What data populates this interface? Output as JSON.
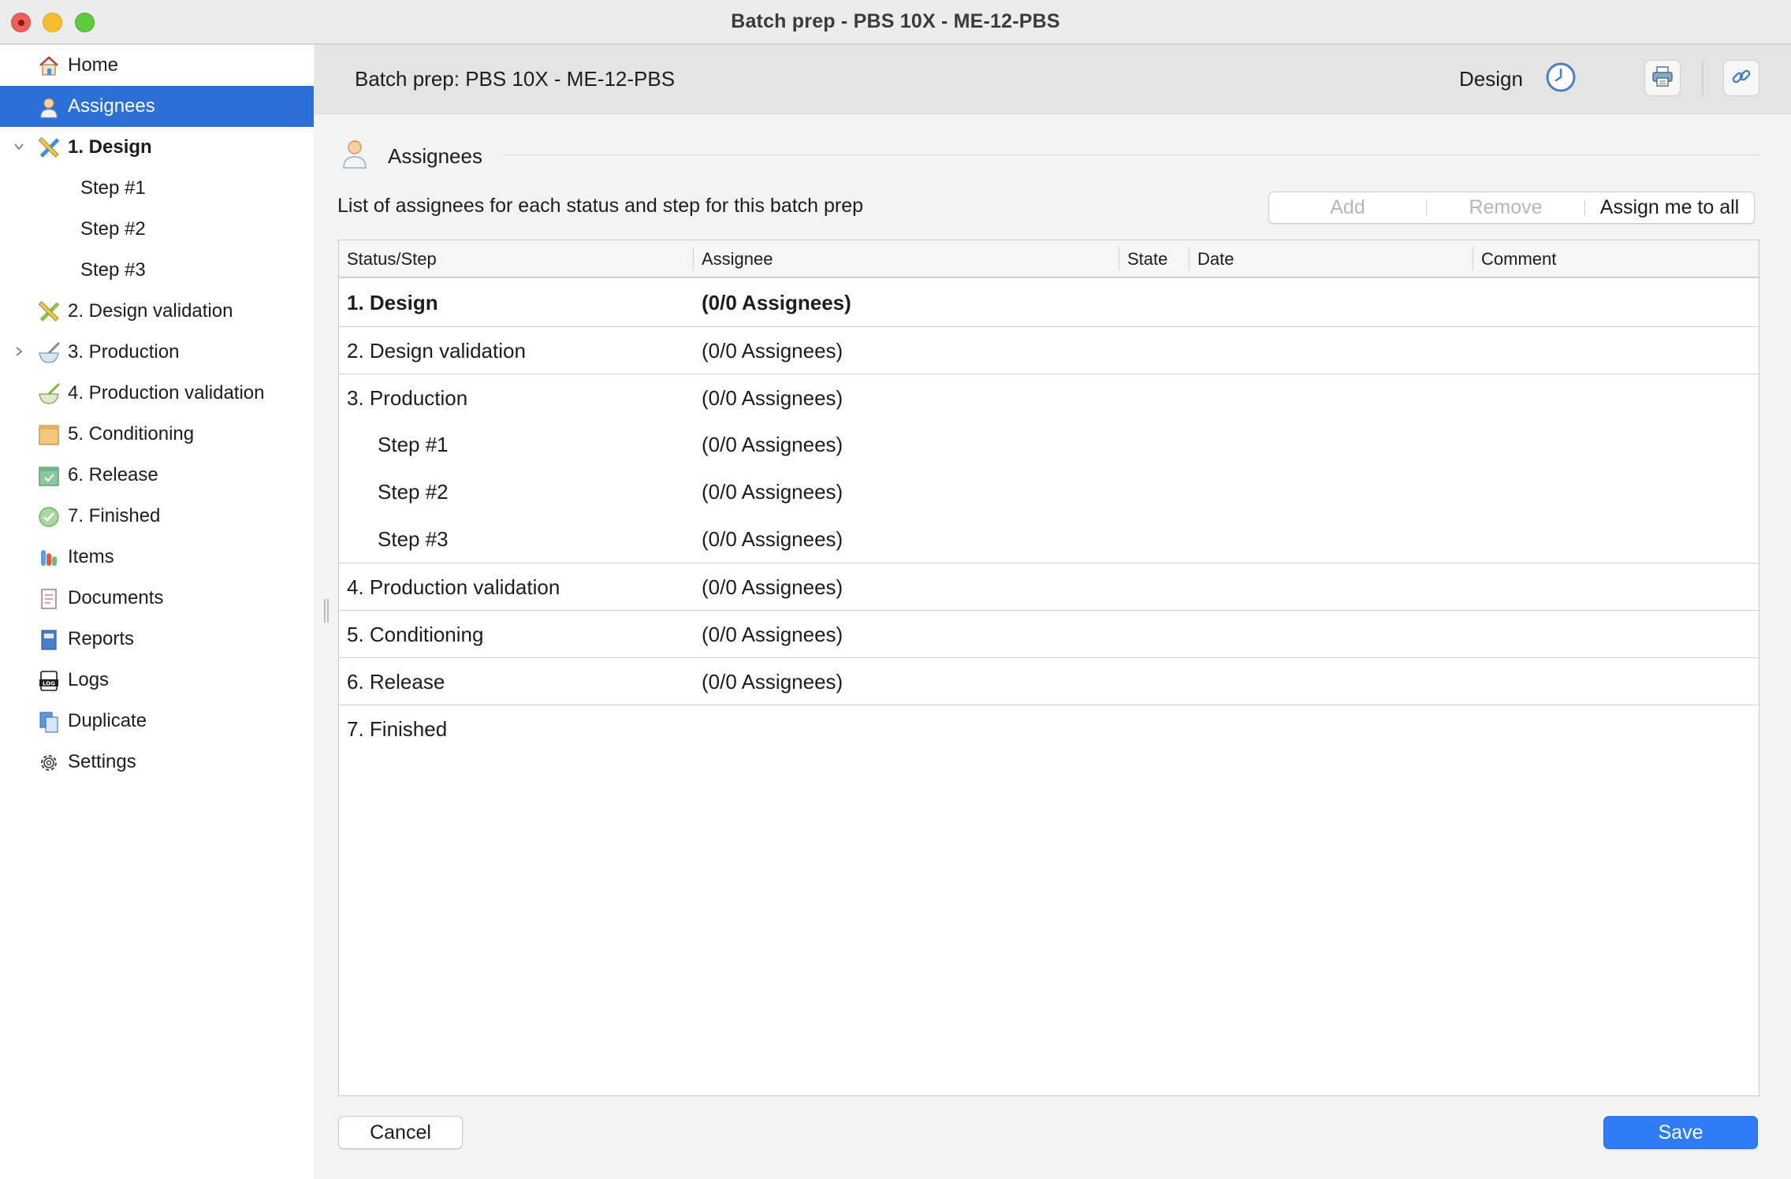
{
  "window": {
    "title": "Batch prep - PBS 10X - ME-12-PBS"
  },
  "sidebar": {
    "items": [
      {
        "label": "Home",
        "icon": "home-icon",
        "selected": false
      },
      {
        "label": "Assignees",
        "icon": "user-icon",
        "selected": true
      },
      {
        "label": "1. Design",
        "icon": "pencil-ruler-icon",
        "expanded": true
      },
      {
        "label": "Step #1"
      },
      {
        "label": "Step #2"
      },
      {
        "label": "Step #3"
      },
      {
        "label": "2. Design validation",
        "icon": "pencil-ruler-check-icon"
      },
      {
        "label": "3. Production",
        "icon": "mortar-icon",
        "collapsed": true
      },
      {
        "label": "4. Production validation",
        "icon": "mortar-check-icon"
      },
      {
        "label": "5. Conditioning",
        "icon": "box-icon"
      },
      {
        "label": "6. Release",
        "icon": "release-box-icon"
      },
      {
        "label": "7. Finished",
        "icon": "check-circle-icon"
      },
      {
        "label": "Items",
        "icon": "flasks-icon"
      },
      {
        "label": "Documents",
        "icon": "document-icon"
      },
      {
        "label": "Reports",
        "icon": "report-book-icon"
      },
      {
        "label": "Logs",
        "icon": "log-icon"
      },
      {
        "label": "Duplicate",
        "icon": "duplicate-icon"
      },
      {
        "label": "Settings",
        "icon": "gear-icon"
      }
    ]
  },
  "header": {
    "title": "Batch prep: PBS 10X - ME-12-PBS",
    "status": "Design"
  },
  "section": {
    "title": "Assignees",
    "description": "List of assignees for each status and step for this batch prep"
  },
  "actions": {
    "add": "Add",
    "remove": "Remove",
    "assign_all": "Assign me to all"
  },
  "table": {
    "columns": [
      "Status/Step",
      "Assignee",
      "State",
      "Date",
      "Comment"
    ],
    "rows": [
      {
        "step": "1. Design",
        "assignee": "(0/0 Assignees)",
        "bold": true
      },
      {
        "step": "2. Design validation",
        "assignee": "(0/0 Assignees)"
      },
      {
        "step": "3. Production",
        "assignee": "(0/0 Assignees)"
      },
      {
        "step": "Step #1",
        "assignee": "(0/0 Assignees)",
        "indent": true
      },
      {
        "step": "Step #2",
        "assignee": "(0/0 Assignees)",
        "indent": true
      },
      {
        "step": "Step #3",
        "assignee": "(0/0 Assignees)",
        "indent": true
      },
      {
        "step": "4. Production validation",
        "assignee": "(0/0 Assignees)"
      },
      {
        "step": "5. Conditioning",
        "assignee": "(0/0 Assignees)"
      },
      {
        "step": "6. Release",
        "assignee": "(0/0 Assignees)"
      },
      {
        "step": "7. Finished",
        "assignee": ""
      }
    ]
  },
  "footer": {
    "cancel": "Cancel",
    "save": "Save"
  },
  "colors": {
    "selection": "#2b6fd8",
    "primary_button": "#2f7cf6",
    "header_bg": "#e4e4e4"
  }
}
